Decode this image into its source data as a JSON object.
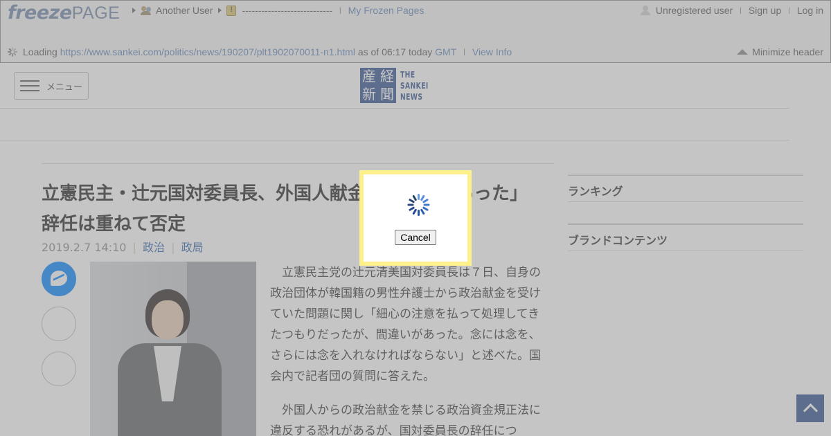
{
  "freezepage": {
    "logo_part1": "freeze",
    "logo_part2": "PAGE",
    "owner_user": "Another User",
    "folder_name": "----------------------------",
    "my_frozen_pages": "My Frozen Pages",
    "unregistered_user": "Unregistered user",
    "sign_up": "Sign up",
    "log_in": "Log in",
    "loading_label": "Loading",
    "loading_url": "https://www.sankei.com/politics/news/190207/plt1902070011-n1.html",
    "as_of": "as of 06:17 today",
    "gmt": "GMT",
    "view_info": "View Info",
    "minimize_header": "Minimize header",
    "separator": "|",
    "link_color": "#5d84b8"
  },
  "site": {
    "menu_label": "メニュー",
    "logo_kanji": [
      "産",
      "経",
      "新",
      "聞"
    ],
    "logo_en": [
      "THE",
      "SANKEI",
      "NEWS"
    ],
    "brand_color": "#2d4f8e"
  },
  "article": {
    "headline": "立憲民主・辻元国対委員長、外国人献金「間違いがあった」　辞任は重ねて否定",
    "date": "2019.2.7 14:10",
    "category1": "政治",
    "category2": "政局",
    "divider": "|",
    "paragraph1": "　立憲民主党の辻元清美国対委員長は７日、自身の政治団体が韓国籍の男性弁護士から政治献金を受けていた問題に関し「細心の注意を払って処理してきたつもりだったが、間違いがあった。念には念を、さらには念を入れなければならない」と述べた。国会内で記者団の質問に答えた。",
    "paragraph2": "　外国人からの政治献金を禁じる政治資金規正法に違反する恐れがあるが、国対委員長の辞任につ"
  },
  "sidebar": {
    "ranking_title": "ランキング",
    "brand_title": "ブランドコンテンツ"
  },
  "dialog": {
    "cancel_label": "Cancel",
    "highlight_color": "#fef08a"
  },
  "icons": {
    "share_messenger": "messenger-icon",
    "back_to_top": "chevron-up-icon",
    "loading": "spinner-icon"
  }
}
